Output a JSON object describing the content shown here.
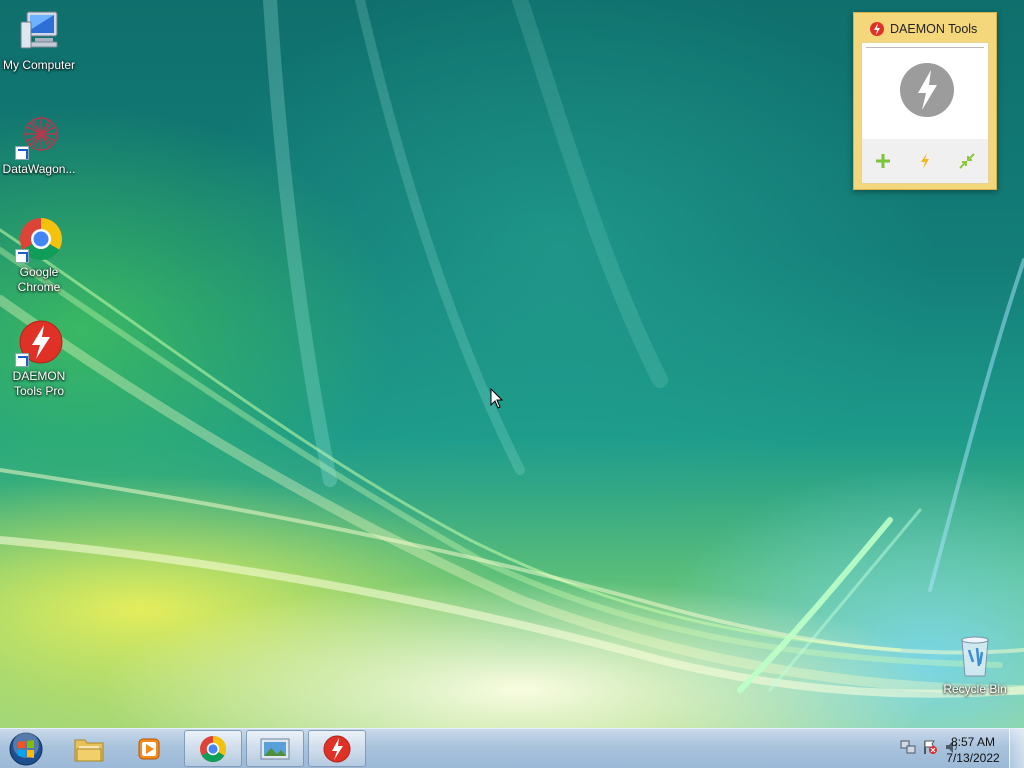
{
  "desktop": {
    "icons": [
      {
        "label": "My Computer",
        "icon": "computer-icon"
      },
      {
        "label": "DataWagon...",
        "icon": "datawagon-icon"
      },
      {
        "label": "Google Chrome",
        "icon": "chrome-icon"
      },
      {
        "label": "DAEMON Tools Pro",
        "icon": "daemon-tools-icon"
      },
      {
        "label": "Recycle Bin",
        "icon": "recycle-bin-icon"
      }
    ]
  },
  "gadget": {
    "title": "DAEMON Tools",
    "buttons": [
      {
        "icon": "plus-icon",
        "color": "#7cc43a"
      },
      {
        "icon": "lightning-icon",
        "color": "#f3b71c"
      },
      {
        "icon": "arrows-icon",
        "color": "#8cc63f"
      }
    ]
  },
  "taskbar": {
    "items": [
      "start-orb",
      "windows-explorer",
      "media-player",
      "google-chrome",
      "image-viewer",
      "daemon-tools"
    ],
    "clock": {
      "time": "8:57 AM",
      "date": "7/13/2022"
    }
  },
  "colors": {
    "daemon_red": "#e03127",
    "gadget_bg": "#f5d77b"
  }
}
